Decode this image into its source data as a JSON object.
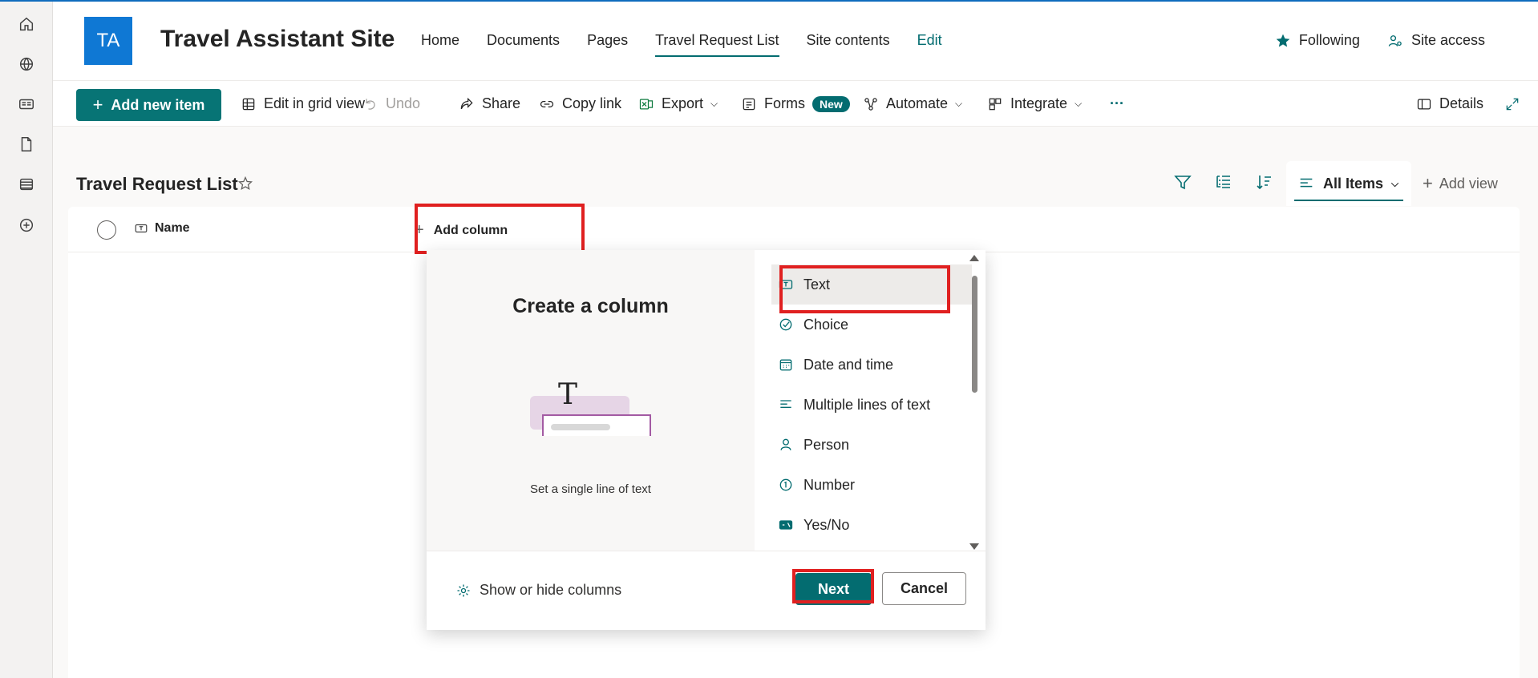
{
  "site": {
    "logo_initials": "TA",
    "title": "Travel Assistant Site",
    "nav": [
      "Home",
      "Documents",
      "Pages",
      "Travel Request List",
      "Site contents",
      "Edit"
    ],
    "following_label": "Following",
    "site_access_label": "Site access"
  },
  "commands": {
    "add_new_item": "Add new item",
    "edit_grid": "Edit in grid view",
    "undo": "Undo",
    "share": "Share",
    "copy_link": "Copy link",
    "export": "Export",
    "forms": "Forms",
    "forms_badge": "New",
    "automate": "Automate",
    "integrate": "Integrate",
    "more": "···",
    "details": "Details"
  },
  "list": {
    "title": "Travel Request List",
    "view_name": "All Items",
    "add_view": "Add view",
    "columns": {
      "name": "Name",
      "add_column": "Add column"
    }
  },
  "create_column": {
    "title": "Create a column",
    "illustration_glyph": "T",
    "description": "Set a single line of text",
    "types": [
      {
        "label": "Text",
        "icon": "text-box-icon"
      },
      {
        "label": "Choice",
        "icon": "check-circle-icon"
      },
      {
        "label": "Date and time",
        "icon": "calendar-icon"
      },
      {
        "label": "Multiple lines of text",
        "icon": "lines-icon"
      },
      {
        "label": "Person",
        "icon": "person-icon"
      },
      {
        "label": "Number",
        "icon": "number-circle-icon"
      },
      {
        "label": "Yes/No",
        "icon": "toggle-icon"
      }
    ],
    "selected_type": "Text",
    "show_hide": "Show or hide columns",
    "next": "Next",
    "cancel": "Cancel"
  },
  "colors": {
    "accent": "#036c70",
    "logo_bg": "#0f78d4",
    "highlight": "#e02020"
  }
}
